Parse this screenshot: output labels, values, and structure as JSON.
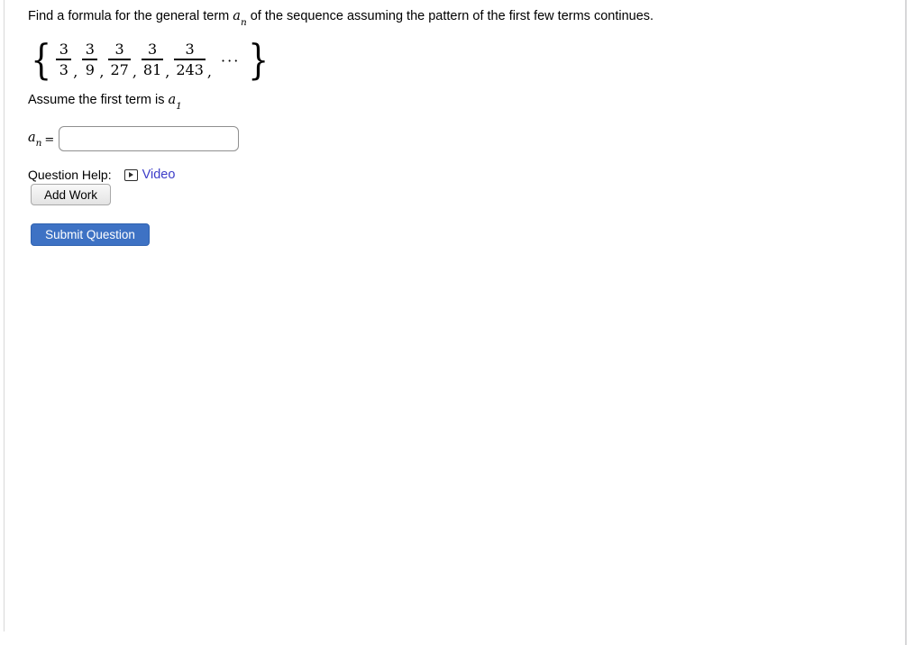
{
  "question": {
    "prompt_part1": "Find a formula for the general term ",
    "prompt_var": "a",
    "prompt_var_sub": "n",
    "prompt_part2": " of the sequence assuming the pattern of the first few terms continues."
  },
  "sequence": {
    "open_brace": "{",
    "close_brace": "}",
    "terms": [
      {
        "numerator": "3",
        "denominator": "3"
      },
      {
        "numerator": "3",
        "denominator": "9"
      },
      {
        "numerator": "3",
        "denominator": "27"
      },
      {
        "numerator": "3",
        "denominator": "81"
      },
      {
        "numerator": "3",
        "denominator": "243"
      }
    ],
    "separator": ",",
    "ellipsis": "···"
  },
  "assume": {
    "text": "Assume the first term is ",
    "var": "a",
    "var_sub": "1"
  },
  "answer": {
    "label_var": "a",
    "label_sub": "n",
    "equals": "=",
    "value": "",
    "placeholder": ""
  },
  "question_help": {
    "label": "Question Help:",
    "video_icon": "video-play-icon",
    "video_label": "Video"
  },
  "buttons": {
    "add_work": "Add Work",
    "submit": "Submit Question"
  },
  "colors": {
    "submit_background": "#3e72c4",
    "submit_text": "#ffffff",
    "link": "#3c3cc8",
    "input_border": "#8f8f8f"
  }
}
